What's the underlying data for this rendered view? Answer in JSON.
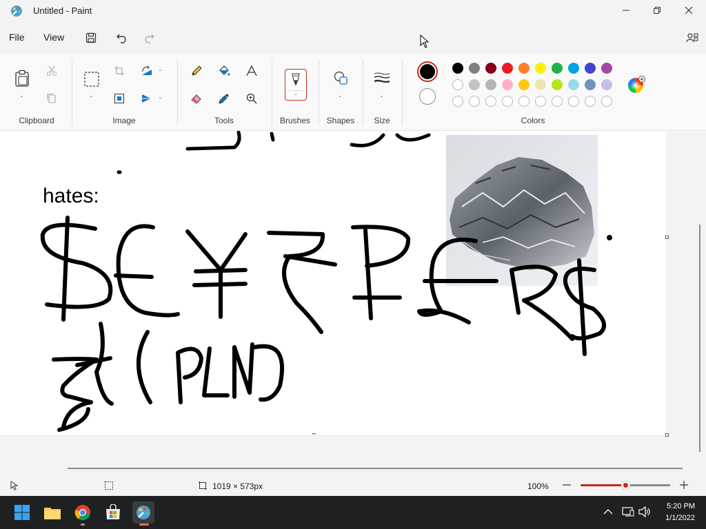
{
  "window": {
    "title": "Untitled - Paint",
    "app_icon": "paint-palette-icon"
  },
  "menu": {
    "file": "File",
    "view": "View"
  },
  "ribbon": {
    "groups": {
      "clipboard": "Clipboard",
      "image": "Image",
      "tools": "Tools",
      "brushes": "Brushes",
      "shapes": "Shapes",
      "size": "Size",
      "colors": "Colors"
    }
  },
  "colors": {
    "primary": "#000000",
    "secondary": "#ffffff",
    "palette_row1": [
      "#000000",
      "#7f7f7f",
      "#880015",
      "#ed1c24",
      "#ff7f27",
      "#fff200",
      "#22b14c",
      "#00a2e8",
      "#3f48cc",
      "#a349a4"
    ],
    "palette_row2": [
      "#ffffff",
      "#c3c3c3",
      "#b5b5b5",
      "#ffaec9",
      "#ffc90e",
      "#efe4b0",
      "#b5e61d",
      "#99d9ea",
      "#7092be",
      "#c8bfe7"
    ],
    "accent": "#c42b1c"
  },
  "canvas": {
    "text_hates": "hates:",
    "handwriting_row1": "$€¥₹₽£R$",
    "handwriting_row2": "zł (PLN)"
  },
  "status": {
    "canvas_size": "1019 × 573px",
    "zoom": "100%",
    "zoom_level_fraction": 0.5
  },
  "taskbar": {
    "time": "5:20 PM",
    "date": "1/1/2022"
  }
}
